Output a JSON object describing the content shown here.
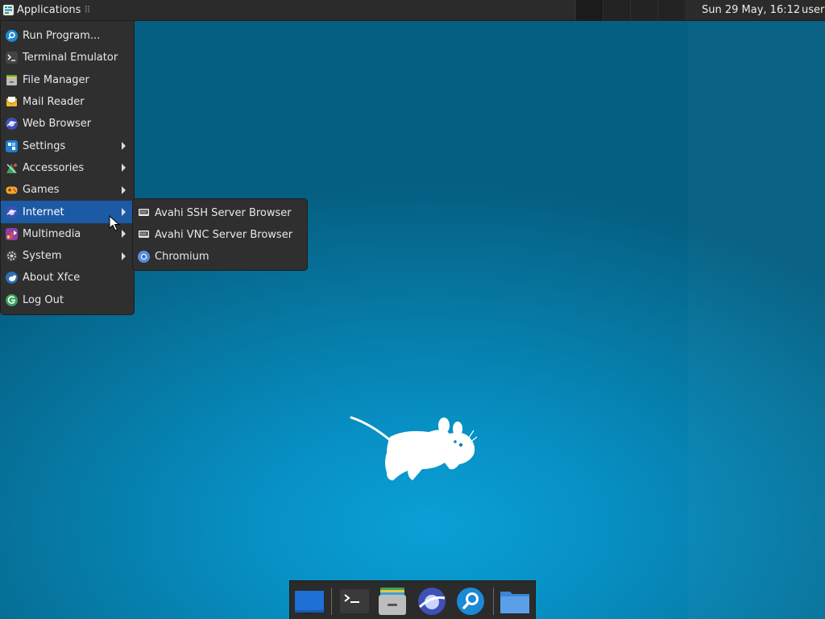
{
  "panel": {
    "apps_label": "Applications",
    "clock": "Sun 29 May, 16:12",
    "user": "user"
  },
  "menu": {
    "items": [
      {
        "label": "Run Program...",
        "icon": "search-icon"
      },
      {
        "label": "Terminal Emulator",
        "icon": "terminal-icon"
      },
      {
        "label": "File Manager",
        "icon": "file-manager-icon"
      },
      {
        "label": "Mail Reader",
        "icon": "mail-icon"
      },
      {
        "label": "Web Browser",
        "icon": "web-browser-icon"
      },
      {
        "label": "Settings",
        "icon": "settings-icon",
        "submenu": true
      },
      {
        "label": "Accessories",
        "icon": "accessories-icon",
        "submenu": true
      },
      {
        "label": "Games",
        "icon": "games-icon",
        "submenu": true
      },
      {
        "label": "Internet",
        "icon": "internet-icon",
        "submenu": true,
        "active": true
      },
      {
        "label": "Multimedia",
        "icon": "multimedia-icon",
        "submenu": true
      },
      {
        "label": "System",
        "icon": "system-icon",
        "submenu": true
      },
      {
        "label": "About Xfce",
        "icon": "about-xfce-icon"
      },
      {
        "label": "Log Out",
        "icon": "log-out-icon"
      }
    ]
  },
  "internet_submenu": {
    "items": [
      {
        "label": "Avahi SSH Server Browser",
        "icon": "network-icon"
      },
      {
        "label": "Avahi VNC Server Browser",
        "icon": "network-icon"
      },
      {
        "label": "Chromium",
        "icon": "chromium-icon"
      }
    ]
  },
  "dock": {
    "items": [
      {
        "name": "show-desktop",
        "icon": "show-desktop-icon"
      },
      {
        "name": "terminal",
        "icon": "terminal-icon"
      },
      {
        "name": "file-manager",
        "icon": "file-manager-icon"
      },
      {
        "name": "web-browser",
        "icon": "web-browser-icon"
      },
      {
        "name": "app-finder",
        "icon": "search-icon"
      },
      {
        "name": "home-folder",
        "icon": "folder-icon"
      }
    ]
  },
  "colors": {
    "panel_bg": "#2b2b2b",
    "menu_bg": "#2f2f2f",
    "highlight": "#1c5aa6",
    "wallpaper": "#0790c4"
  }
}
